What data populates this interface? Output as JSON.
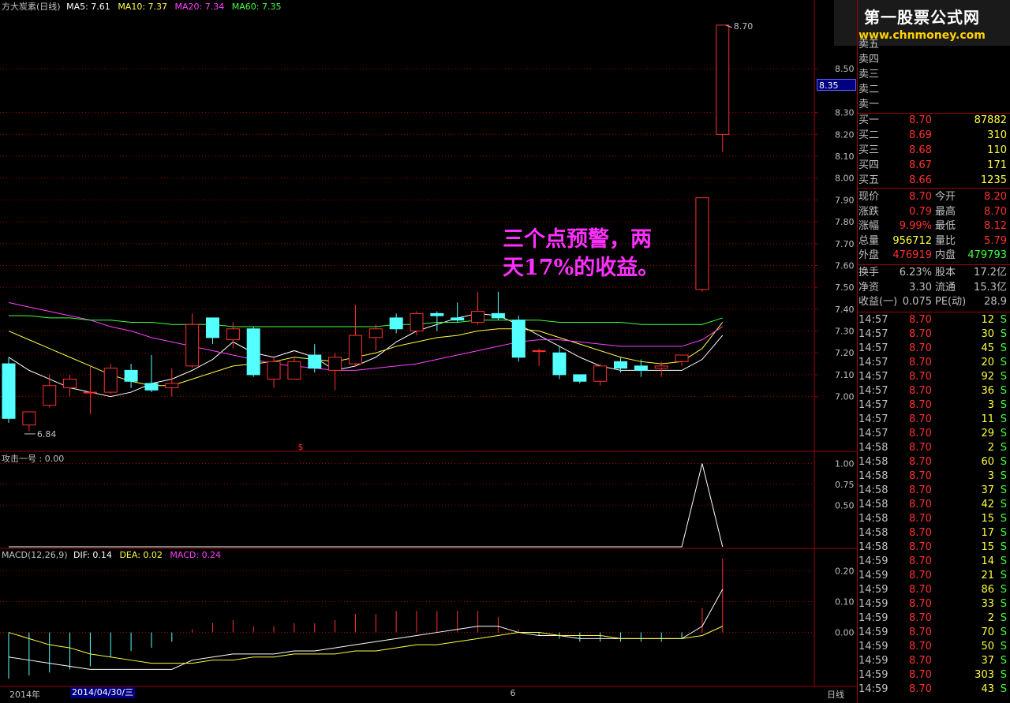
{
  "header": {
    "stock_name": "方大炭素(日线)",
    "ma5": "MA5: 7.61",
    "ma10": "MA10: 7.37",
    "ma20": "MA20: 7.34",
    "ma60": "MA60: 7.35"
  },
  "brand": {
    "line1": "第一股票公式网",
    "line2": "www.chnmoney.com"
  },
  "annotation": {
    "line1": "三个点预警，两",
    "line2": "天17%的收益。"
  },
  "colors": {
    "up": "#ff3030",
    "down": "#54ffff",
    "ma5": "#ffffff",
    "ma10": "#ffff40",
    "ma20": "#ff40ff",
    "ma60": "#40ff40",
    "grid": "#a00000"
  },
  "price_tag": "8.35",
  "markers": {
    "high_label": "8.70",
    "low_label": "6.84",
    "dollar": "$",
    "six": "6"
  },
  "indicator1": {
    "title": "攻击一号 : 0.00"
  },
  "macd": {
    "title": "MACD(12,26,9)",
    "dif": "DIF: 0.14",
    "dea": "DEA: 0.02",
    "macd": "MACD: 0.24"
  },
  "bottom": {
    "year": "2014年",
    "date": "2014/04/30/三",
    "period": "日线"
  },
  "chart_data": [
    {
      "type": "candlestick",
      "ylim": [
        6.8,
        8.75
      ],
      "y_ticks": [
        "8.50",
        "8.30",
        "8.20",
        "8.10",
        "8.00",
        "7.90",
        "7.80",
        "7.70",
        "7.60",
        "7.50",
        "7.40",
        "7.30",
        "7.20",
        "7.10",
        "7.00"
      ],
      "candles": [
        {
          "o": 7.15,
          "h": 7.18,
          "l": 6.88,
          "c": 6.9
        },
        {
          "o": 6.87,
          "h": 6.93,
          "l": 6.84,
          "c": 6.93
        },
        {
          "o": 6.96,
          "h": 7.1,
          "l": 6.95,
          "c": 7.05
        },
        {
          "o": 7.04,
          "h": 7.1,
          "l": 7.0,
          "c": 7.08
        },
        {
          "o": 7.02,
          "h": 7.14,
          "l": 6.92,
          "c": 7.02
        },
        {
          "o": 7.02,
          "h": 7.15,
          "l": 7.01,
          "c": 7.13
        },
        {
          "o": 7.12,
          "h": 7.15,
          "l": 7.04,
          "c": 7.07
        },
        {
          "o": 7.06,
          "h": 7.19,
          "l": 7.02,
          "c": 7.03
        },
        {
          "o": 7.04,
          "h": 7.13,
          "l": 7.0,
          "c": 7.06
        },
        {
          "o": 7.14,
          "h": 7.38,
          "l": 7.13,
          "c": 7.33
        },
        {
          "o": 7.36,
          "h": 7.36,
          "l": 7.24,
          "c": 7.27
        },
        {
          "o": 7.26,
          "h": 7.34,
          "l": 7.22,
          "c": 7.31
        },
        {
          "o": 7.31,
          "h": 7.32,
          "l": 7.09,
          "c": 7.1
        },
        {
          "o": 7.08,
          "h": 7.18,
          "l": 7.04,
          "c": 7.16
        },
        {
          "o": 7.08,
          "h": 7.18,
          "l": 7.08,
          "c": 7.16
        },
        {
          "o": 7.19,
          "h": 7.24,
          "l": 7.11,
          "c": 7.13
        },
        {
          "o": 7.12,
          "h": 7.2,
          "l": 7.03,
          "c": 7.18
        },
        {
          "o": 7.15,
          "h": 7.42,
          "l": 7.14,
          "c": 7.28
        },
        {
          "o": 7.27,
          "h": 7.33,
          "l": 7.21,
          "c": 7.31
        },
        {
          "o": 7.36,
          "h": 7.38,
          "l": 7.29,
          "c": 7.31
        },
        {
          "o": 7.3,
          "h": 7.39,
          "l": 7.28,
          "c": 7.38
        },
        {
          "o": 7.38,
          "h": 7.39,
          "l": 7.3,
          "c": 7.37
        },
        {
          "o": 7.36,
          "h": 7.43,
          "l": 7.34,
          "c": 7.35
        },
        {
          "o": 7.34,
          "h": 7.48,
          "l": 7.33,
          "c": 7.39
        },
        {
          "o": 7.38,
          "h": 7.48,
          "l": 7.35,
          "c": 7.36
        },
        {
          "o": 7.35,
          "h": 7.37,
          "l": 7.16,
          "c": 7.18
        },
        {
          "o": 7.21,
          "h": 7.22,
          "l": 7.14,
          "c": 7.21
        },
        {
          "o": 7.2,
          "h": 7.23,
          "l": 7.08,
          "c": 7.1
        },
        {
          "o": 7.1,
          "h": 7.1,
          "l": 7.06,
          "c": 7.07
        },
        {
          "o": 7.07,
          "h": 7.15,
          "l": 7.05,
          "c": 7.14
        },
        {
          "o": 7.16,
          "h": 7.18,
          "l": 7.11,
          "c": 7.13
        },
        {
          "o": 7.14,
          "h": 7.17,
          "l": 7.09,
          "c": 7.12
        },
        {
          "o": 7.13,
          "h": 7.16,
          "l": 7.09,
          "c": 7.14
        },
        {
          "o": 7.16,
          "h": 7.19,
          "l": 7.14,
          "c": 7.19
        },
        {
          "o": 7.49,
          "h": 7.91,
          "l": 7.48,
          "c": 7.91
        },
        {
          "o": 8.2,
          "h": 8.7,
          "l": 8.12,
          "c": 8.7
        }
      ],
      "ma": [
        {
          "name": "MA5",
          "values": [
            7.18,
            7.12,
            7.08,
            7.04,
            7.02,
            7.0,
            7.02,
            7.06,
            7.08,
            7.12,
            7.17,
            7.25,
            7.2,
            7.18,
            7.21,
            7.18,
            7.12,
            7.14,
            7.18,
            7.25,
            7.3,
            7.33,
            7.36,
            7.38,
            7.37,
            7.33,
            7.28,
            7.23,
            7.18,
            7.14,
            7.12,
            7.12,
            7.12,
            7.12,
            7.17,
            7.28
          ]
        },
        {
          "name": "MA10",
          "values": [
            7.3,
            7.26,
            7.22,
            7.18,
            7.14,
            7.1,
            7.07,
            7.05,
            7.05,
            7.08,
            7.11,
            7.14,
            7.15,
            7.16,
            7.18,
            7.17,
            7.16,
            7.18,
            7.2,
            7.23,
            7.25,
            7.27,
            7.28,
            7.3,
            7.31,
            7.31,
            7.3,
            7.27,
            7.24,
            7.21,
            7.18,
            7.16,
            7.15,
            7.16,
            7.22,
            7.34
          ]
        },
        {
          "name": "MA20",
          "values": [
            7.43,
            7.41,
            7.39,
            7.37,
            7.35,
            7.32,
            7.3,
            7.27,
            7.25,
            7.23,
            7.21,
            7.19,
            7.17,
            7.15,
            7.14,
            7.13,
            7.12,
            7.12,
            7.13,
            7.14,
            7.15,
            7.17,
            7.19,
            7.21,
            7.23,
            7.25,
            7.26,
            7.26,
            7.25,
            7.24,
            7.23,
            7.23,
            7.23,
            7.23,
            7.26,
            7.32
          ]
        },
        {
          "name": "MA60",
          "values": [
            7.37,
            7.37,
            7.36,
            7.36,
            7.35,
            7.35,
            7.34,
            7.34,
            7.33,
            7.33,
            7.33,
            7.32,
            7.32,
            7.32,
            7.32,
            7.32,
            7.32,
            7.32,
            7.32,
            7.33,
            7.33,
            7.34,
            7.34,
            7.35,
            7.35,
            7.35,
            7.35,
            7.34,
            7.34,
            7.34,
            7.34,
            7.33,
            7.33,
            7.33,
            7.33,
            7.36
          ]
        }
      ]
    },
    {
      "type": "line",
      "title": "攻击一号",
      "ylim": [
        0,
        1.1
      ],
      "y_ticks": [
        "1.00",
        "0.75",
        "0.50"
      ],
      "values": [
        0,
        0,
        0,
        0,
        0,
        0,
        0,
        0,
        0,
        0,
        0,
        0,
        0,
        0,
        0,
        0,
        0,
        0,
        0,
        0,
        0,
        0,
        0,
        0,
        0,
        0,
        0,
        0,
        0,
        0,
        0,
        0,
        0,
        0,
        1,
        0
      ]
    },
    {
      "type": "bar",
      "title": "MACD(12,26,9)",
      "ylim": [
        -0.16,
        0.25
      ],
      "y_ticks": [
        "0.20",
        "0.10",
        "0.00"
      ],
      "macd": [
        -0.15,
        -0.14,
        -0.13,
        -0.12,
        -0.11,
        -0.08,
        -0.06,
        -0.05,
        -0.03,
        0.01,
        0.03,
        0.04,
        0.02,
        0.02,
        0.03,
        0.03,
        0.04,
        0.06,
        0.06,
        0.07,
        0.07,
        0.07,
        0.07,
        0.07,
        0.05,
        0.01,
        -0.01,
        -0.02,
        -0.03,
        -0.03,
        -0.03,
        -0.03,
        -0.03,
        -0.02,
        0.08,
        0.24
      ],
      "dif": [
        -0.08,
        -0.09,
        -0.1,
        -0.11,
        -0.12,
        -0.12,
        -0.12,
        -0.12,
        -0.12,
        -0.09,
        -0.08,
        -0.07,
        -0.07,
        -0.07,
        -0.06,
        -0.06,
        -0.05,
        -0.04,
        -0.03,
        -0.02,
        -0.01,
        0.0,
        0.01,
        0.02,
        0.02,
        0.0,
        -0.01,
        -0.01,
        -0.02,
        -0.02,
        -0.02,
        -0.02,
        -0.02,
        -0.02,
        0.02,
        0.14
      ],
      "dea": [
        0.0,
        -0.02,
        -0.04,
        -0.05,
        -0.07,
        -0.08,
        -0.09,
        -0.1,
        -0.1,
        -0.1,
        -0.09,
        -0.09,
        -0.08,
        -0.08,
        -0.07,
        -0.07,
        -0.07,
        -0.06,
        -0.06,
        -0.05,
        -0.04,
        -0.04,
        -0.03,
        -0.02,
        -0.01,
        0.0,
        0.0,
        -0.01,
        -0.01,
        -0.01,
        -0.02,
        -0.02,
        -0.02,
        -0.02,
        -0.01,
        0.02
      ]
    }
  ],
  "quote": {
    "sell": [
      "卖五",
      "卖四",
      "卖三",
      "卖二",
      "卖一"
    ],
    "buy": [
      {
        "label": "买一",
        "price": "8.70",
        "vol": "87882"
      },
      {
        "label": "买二",
        "price": "8.69",
        "vol": "310"
      },
      {
        "label": "买三",
        "price": "8.68",
        "vol": "110"
      },
      {
        "label": "买四",
        "price": "8.67",
        "vol": "171"
      },
      {
        "label": "买五",
        "price": "8.66",
        "vol": "1235"
      }
    ],
    "stats": [
      {
        "l1": "现价",
        "v1": "8.70",
        "c1": "#ff3030",
        "l2": "今开",
        "v2": "8.20",
        "c2": "#ff3030"
      },
      {
        "l1": "涨跌",
        "v1": "0.79",
        "c1": "#ff3030",
        "l2": "最高",
        "v2": "8.70",
        "c2": "#ff3030"
      },
      {
        "l1": "涨幅",
        "v1": "9.99%",
        "c1": "#ff3030",
        "l2": "最低",
        "v2": "8.12",
        "c2": "#ff3030"
      },
      {
        "l1": "总量",
        "v1": "956712",
        "c1": "#ffff40",
        "l2": "量比",
        "v2": "5.79",
        "c2": "#ff3030"
      },
      {
        "l1": "外盘",
        "v1": "476919",
        "c1": "#ff3030",
        "l2": "内盘",
        "v2": "479793",
        "c2": "#40ff40"
      }
    ],
    "stats2": [
      {
        "l1": "换手",
        "v1": "6.23%",
        "l2": "股本",
        "v2": "17.2亿"
      },
      {
        "l1": "净资",
        "v1": "3.30",
        "l2": "流通",
        "v2": "15.3亿"
      },
      {
        "l1": "收益(一)",
        "v1": "0.075",
        "l2": "PE(动)",
        "v2": "28.9"
      }
    ],
    "ticks": [
      {
        "t": "14:57",
        "p": "8.70",
        "v": "12",
        "s": "S"
      },
      {
        "t": "14:57",
        "p": "8.70",
        "v": "30",
        "s": "S"
      },
      {
        "t": "14:57",
        "p": "8.70",
        "v": "45",
        "s": "S"
      },
      {
        "t": "14:57",
        "p": "8.70",
        "v": "20",
        "s": "S"
      },
      {
        "t": "14:57",
        "p": "8.70",
        "v": "92",
        "s": "S"
      },
      {
        "t": "14:57",
        "p": "8.70",
        "v": "36",
        "s": "S"
      },
      {
        "t": "14:57",
        "p": "8.70",
        "v": "3",
        "s": "S"
      },
      {
        "t": "14:57",
        "p": "8.70",
        "v": "11",
        "s": "S"
      },
      {
        "t": "14:57",
        "p": "8.70",
        "v": "29",
        "s": "S"
      },
      {
        "t": "14:58",
        "p": "8.70",
        "v": "2",
        "s": "S"
      },
      {
        "t": "14:58",
        "p": "8.70",
        "v": "60",
        "s": "S"
      },
      {
        "t": "14:58",
        "p": "8.70",
        "v": "3",
        "s": "S"
      },
      {
        "t": "14:58",
        "p": "8.70",
        "v": "37",
        "s": "S"
      },
      {
        "t": "14:58",
        "p": "8.70",
        "v": "42",
        "s": "S"
      },
      {
        "t": "14:58",
        "p": "8.70",
        "v": "15",
        "s": "S"
      },
      {
        "t": "14:58",
        "p": "8.70",
        "v": "17",
        "s": "S"
      },
      {
        "t": "14:58",
        "p": "8.70",
        "v": "15",
        "s": "S"
      },
      {
        "t": "14:59",
        "p": "8.70",
        "v": "14",
        "s": "S"
      },
      {
        "t": "14:59",
        "p": "8.70",
        "v": "21",
        "s": "S"
      },
      {
        "t": "14:59",
        "p": "8.70",
        "v": "86",
        "s": "S"
      },
      {
        "t": "14:59",
        "p": "8.70",
        "v": "33",
        "s": "S"
      },
      {
        "t": "14:59",
        "p": "8.70",
        "v": "2",
        "s": "S"
      },
      {
        "t": "14:59",
        "p": "8.70",
        "v": "70",
        "s": "S"
      },
      {
        "t": "14:59",
        "p": "8.70",
        "v": "50",
        "s": "S"
      },
      {
        "t": "14:59",
        "p": "8.70",
        "v": "37",
        "s": "S"
      },
      {
        "t": "14:59",
        "p": "8.70",
        "v": "303",
        "s": "S"
      },
      {
        "t": "14:59",
        "p": "8.70",
        "v": "43",
        "s": "S"
      }
    ]
  }
}
